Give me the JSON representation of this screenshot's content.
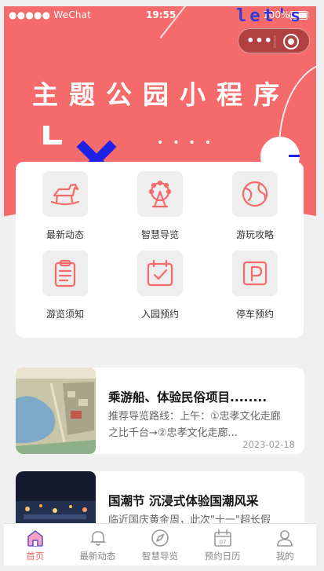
{
  "status_bar": {
    "carrier": "●●●●● WeChat",
    "time": "19:55",
    "battery": "100%"
  },
  "overlay_text": "let's",
  "capsule": {
    "more": "•••"
  },
  "hero": {
    "title": "主题公园小程序"
  },
  "features": [
    {
      "label": "最新动态",
      "icon": "rocking-horse-icon"
    },
    {
      "label": "智慧导览",
      "icon": "ferris-wheel-icon"
    },
    {
      "label": "游玩攻略",
      "icon": "globe-icon"
    },
    {
      "label": "游览须知",
      "icon": "clipboard-icon"
    },
    {
      "label": "入园预约",
      "icon": "calendar-check-icon"
    },
    {
      "label": "停车预约",
      "icon": "parking-icon"
    }
  ],
  "news": [
    {
      "title": "乘游船、体验民俗项目........",
      "desc": "推荐导览路线：上午：①忠孝文化走廊之比千台→②忠孝文化走廊...",
      "date": "2023-02-18"
    },
    {
      "title": "国潮节 沉浸式体验国潮风采",
      "desc": "临近国庆黄金周，此次\"十一\"超长假"
    }
  ],
  "tabbar": [
    {
      "label": "首页",
      "icon": "home-icon",
      "active": true
    },
    {
      "label": "最新动态",
      "icon": "bell-icon"
    },
    {
      "label": "智慧导览",
      "icon": "navigation-icon"
    },
    {
      "label": "预约日历",
      "icon": "calendar-icon"
    },
    {
      "label": "我的",
      "icon": "user-icon"
    }
  ],
  "colors": {
    "primary": "#f56a6b",
    "accent": "#1e22e6",
    "background": "#f0f0f0"
  }
}
